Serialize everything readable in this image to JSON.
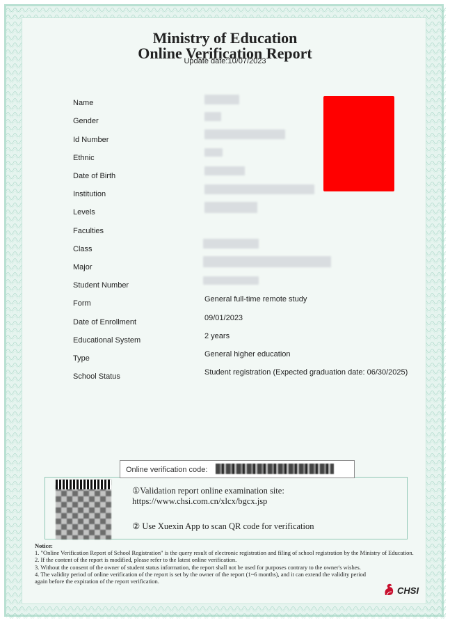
{
  "header": {
    "title_line1": "Ministry of Education",
    "title_line2": "Online Verification Report",
    "update_date": "Update date:10/07/2023"
  },
  "fields": [
    {
      "label": "Name",
      "value": ""
    },
    {
      "label": "Gender",
      "value": ""
    },
    {
      "label": "Id Number",
      "value": ""
    },
    {
      "label": "Ethnic",
      "value": ""
    },
    {
      "label": "Date of Birth",
      "value": ""
    },
    {
      "label": "Institution",
      "value": ""
    },
    {
      "label": "Levels",
      "value": ""
    },
    {
      "label": "Faculties",
      "value": ""
    },
    {
      "label": "Class",
      "value": ""
    },
    {
      "label": "Major",
      "value": ""
    },
    {
      "label": "Student Number",
      "value": ""
    },
    {
      "label": "Form",
      "value": "General full-time remote study"
    },
    {
      "label": "Date of Enrollment",
      "value": "09/01/2023"
    },
    {
      "label": "Educational System",
      "value": "2 years"
    },
    {
      "label": "Type",
      "value": "General higher education"
    },
    {
      "label": "School Status",
      "value": "Student registration (Expected graduation date: 06/30/2025)"
    }
  ],
  "verification": {
    "code_label": "Online verification code:",
    "line1": "①Validation report online examination site:",
    "line2": "https://www.chsi.com.cn/xlcx/bgcx.jsp",
    "line3": "② Use Xuexin App to scan QR code for verification"
  },
  "notice": {
    "title": "Notice:",
    "items": [
      "1. \"Online Verification Report of School Registration\" is the query result of electronic registration and filing of school registration by the Ministry of Education.",
      "2. If the content of the report is modified, please refer to the latest online verification.",
      "3. Without the consent of the owner of student status information, the report shall not be used for purposes contrary to the owner's wishes.",
      "4. The validity period of online verification of the report is set by the owner of the report (1~6 months), and it can extend the validity period again before the expiration of the report verification."
    ]
  },
  "logo": {
    "text": "CHSI"
  },
  "colors": {
    "photo": "#ff0000",
    "border": "#b9e0d2",
    "background": "#e6f4ef"
  }
}
